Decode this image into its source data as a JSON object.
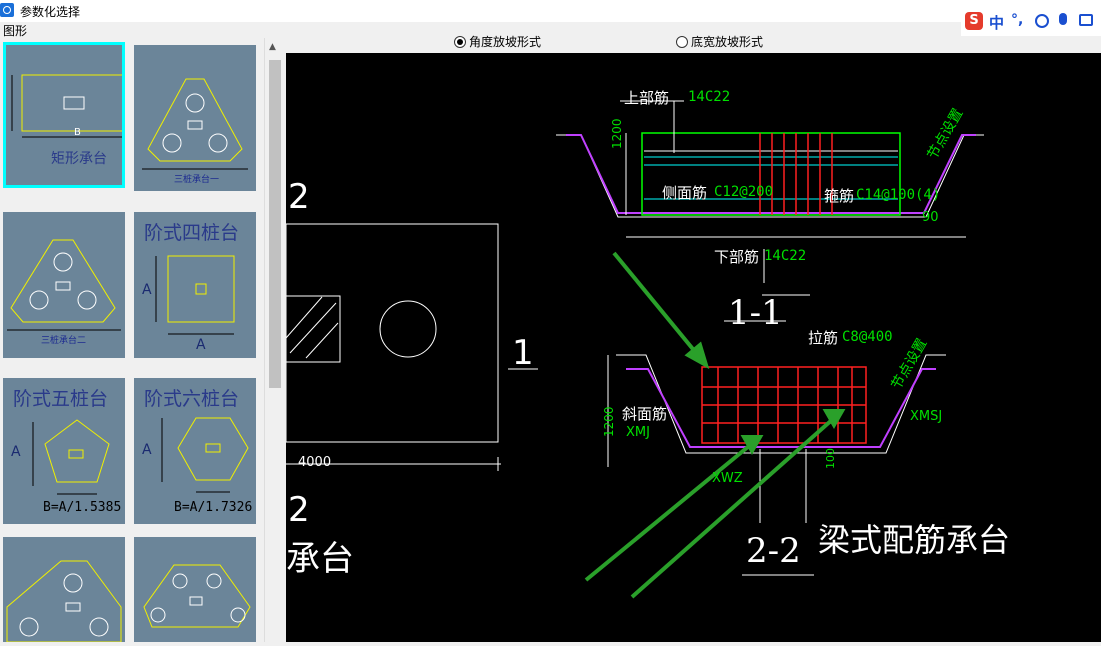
{
  "window": {
    "title": "参数化选择"
  },
  "ime": {
    "logo": "S",
    "mode": "中",
    "punct": "°,"
  },
  "panel": {
    "label": "图形"
  },
  "thumbnails": [
    {
      "name": "矩形承台",
      "dim": "B"
    },
    {
      "name": "三桩承台一"
    },
    {
      "name": "三桩承台二"
    },
    {
      "name": "阶式四桩台",
      "dim_a": "A",
      "dim_b": "A"
    },
    {
      "name": "阶式五桩台",
      "dim_a": "A",
      "formula": "B=A/1.5385"
    },
    {
      "name": "阶式六桩台",
      "dim_a": "A",
      "formula": "B=A/1.7326"
    },
    {
      "name": ""
    },
    {
      "name": ""
    }
  ],
  "options": [
    {
      "label": "角度放坡形式",
      "checked": true
    },
    {
      "label": "底宽放坡形式",
      "checked": false
    }
  ],
  "drawing": {
    "left_labels": {
      "mark_top": "2",
      "mark_right": "1",
      "dim": "4000",
      "mark_bottom": "2",
      "caption_part": "承台"
    },
    "section_1_1": {
      "top_bar": "上部筋",
      "top_bar_spec": "14C22",
      "side_bar": "侧面筋",
      "side_bar_spec": "C12@200",
      "stirrup": "箍筋",
      "stirrup_spec": "C14@100(4)",
      "bottom_bar": "下部筋",
      "bottom_bar_spec": "14C22",
      "height": "1200",
      "angle": "90",
      "node": "节点设置",
      "title": "1-1"
    },
    "section_2_2": {
      "tie_bar": "拉筋",
      "tie_bar_spec": "C8@400",
      "slope_bar": "斜面筋",
      "xmj": "XMJ",
      "xmsj": "XMSJ",
      "xwz": "XWZ",
      "height": "1200",
      "dim_small": "100",
      "node": "节点设置",
      "title": "2-2"
    },
    "annotation": "梁式配筋承台"
  },
  "colors": {
    "cad_bg": "#000000",
    "accent_cyan": "#00ffff",
    "rebar_red": "#ff2020",
    "green_text": "#00e000",
    "arrow_green": "#2aa02a"
  }
}
